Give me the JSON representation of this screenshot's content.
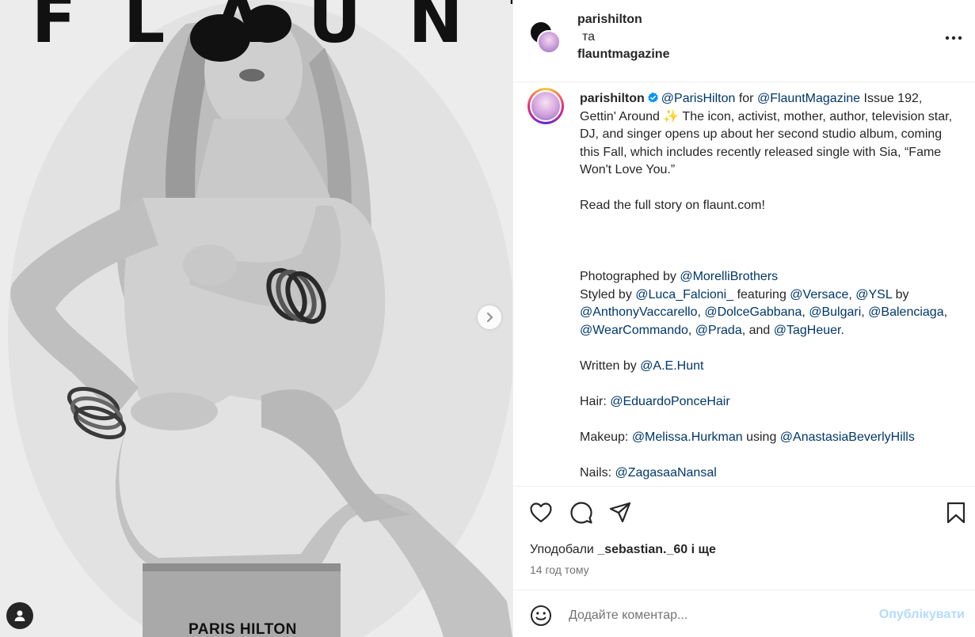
{
  "cover": {
    "masthead": "FLAUNT",
    "name": "PARIS HILTON"
  },
  "header": {
    "user1": "parishilton",
    "and": "та",
    "user2": "flauntmagazine",
    "more_icon": "more-horizontal-icon"
  },
  "caption": {
    "username": "parishilton",
    "line1_mention1": "@ParisHilton",
    "line1_text1": " for ",
    "line1_mention2": "@FlauntMagazine",
    "line1_text2": " Issue 192, Gettin' Around ",
    "line1_emoji": "✨",
    "line1_text3": " The icon, activist, mother, author, television star, DJ, and singer opens up about her second studio album, coming this Fall, which includes recently released single with Sia, “Fame Won't Love You.”",
    "read_more": "Read the full story on flaunt.com!",
    "photo_text": "Photographed by ",
    "photo_mention": "@MorelliBrothers",
    "styled_text": "Styled by ",
    "styled_mention": "@Luca_Falcioni_",
    "featuring_text": " featuring ",
    "m_versace": "@Versace",
    "comma1": ", ",
    "m_ysl": "@YSL",
    "by_text": " by ",
    "m_vaccarello": "@AnthonyVaccarello",
    "comma2": ", ",
    "m_dolce": "@DolceGabbana",
    "comma3": ", ",
    "m_bulgari": "@Bulgari",
    "comma4": ", ",
    "m_balenciaga": "@Balenciaga",
    "comma5": ", ",
    "m_wearcommando": "@WearCommando",
    "comma6": ", ",
    "m_prada": "@Prada",
    "and_text": ", and ",
    "m_tagheuer": "@TagHeuer",
    "period": ".",
    "written_text": "Written by ",
    "written_mention": "@A.E.Hunt",
    "hair_text": "Hair: ",
    "hair_mention": "@EduardoPonceHair",
    "makeup_text": "Makeup: ",
    "makeup_mention": "@Melissa.Hurkman",
    "using_text": " using ",
    "makeup_mention2": "@AnastasiaBeverlyHills",
    "nails_text": "Nails: ",
    "nails_mention": "@ZagasaaNansal"
  },
  "actions": {
    "likes_prefix": "Уподобали ",
    "likes_user": "_sebastian._60",
    "likes_suffix": " і ще",
    "time": "14 год тому"
  },
  "comment": {
    "placeholder": "Додайте коментар...",
    "post_label": "Опублікувати"
  },
  "colors": {
    "mention": "#00376b",
    "verified": "#0095f6",
    "post_disabled": "#b3dbff",
    "secondary_text": "#737373"
  }
}
